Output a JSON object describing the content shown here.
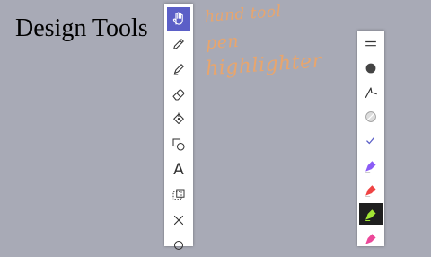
{
  "title": "Design Tools",
  "annotations": [
    "hand tool",
    "pen",
    "highlighter"
  ],
  "accent_color": "#5b5fc7",
  "annotation_color": "#e9a56c",
  "left_toolbar": [
    {
      "name": "hand-tool",
      "icon": "hand-icon",
      "active": true
    },
    {
      "name": "pen-tool",
      "icon": "pen-icon"
    },
    {
      "name": "highlighter-tool",
      "icon": "highlighter-icon"
    },
    {
      "name": "eraser-tool",
      "icon": "eraser-icon"
    },
    {
      "name": "fill-tool",
      "icon": "fill-bucket-icon"
    },
    {
      "name": "shapes-tool",
      "icon": "shapes-icon"
    },
    {
      "name": "text-tool",
      "icon": "text-icon",
      "glyph": "A"
    },
    {
      "name": "lasso-select-tool",
      "icon": "lasso-icon"
    },
    {
      "name": "delete-tool",
      "icon": "close-icon"
    },
    {
      "name": "more-tool",
      "icon": "more-icon"
    }
  ],
  "right_toolbar": [
    {
      "name": "menu",
      "icon": "menu-icon"
    },
    {
      "name": "color-swatch",
      "icon": "circle-icon",
      "color": "#444444"
    },
    {
      "name": "line-style",
      "icon": "line-icon"
    },
    {
      "name": "opacity",
      "icon": "opacity-icon"
    },
    {
      "name": "check",
      "icon": "check-icon"
    },
    {
      "name": "purple-highlighter",
      "icon": "highlighter-icon",
      "color": "#8b5cf6"
    },
    {
      "name": "red-highlighter",
      "icon": "highlighter-icon",
      "color": "#ef4444"
    },
    {
      "name": "green-highlighter",
      "icon": "highlighter-icon",
      "color": "#a3e635",
      "selected": true
    },
    {
      "name": "pink-highlighter",
      "icon": "highlighter-icon",
      "color": "#ec4899"
    }
  ]
}
